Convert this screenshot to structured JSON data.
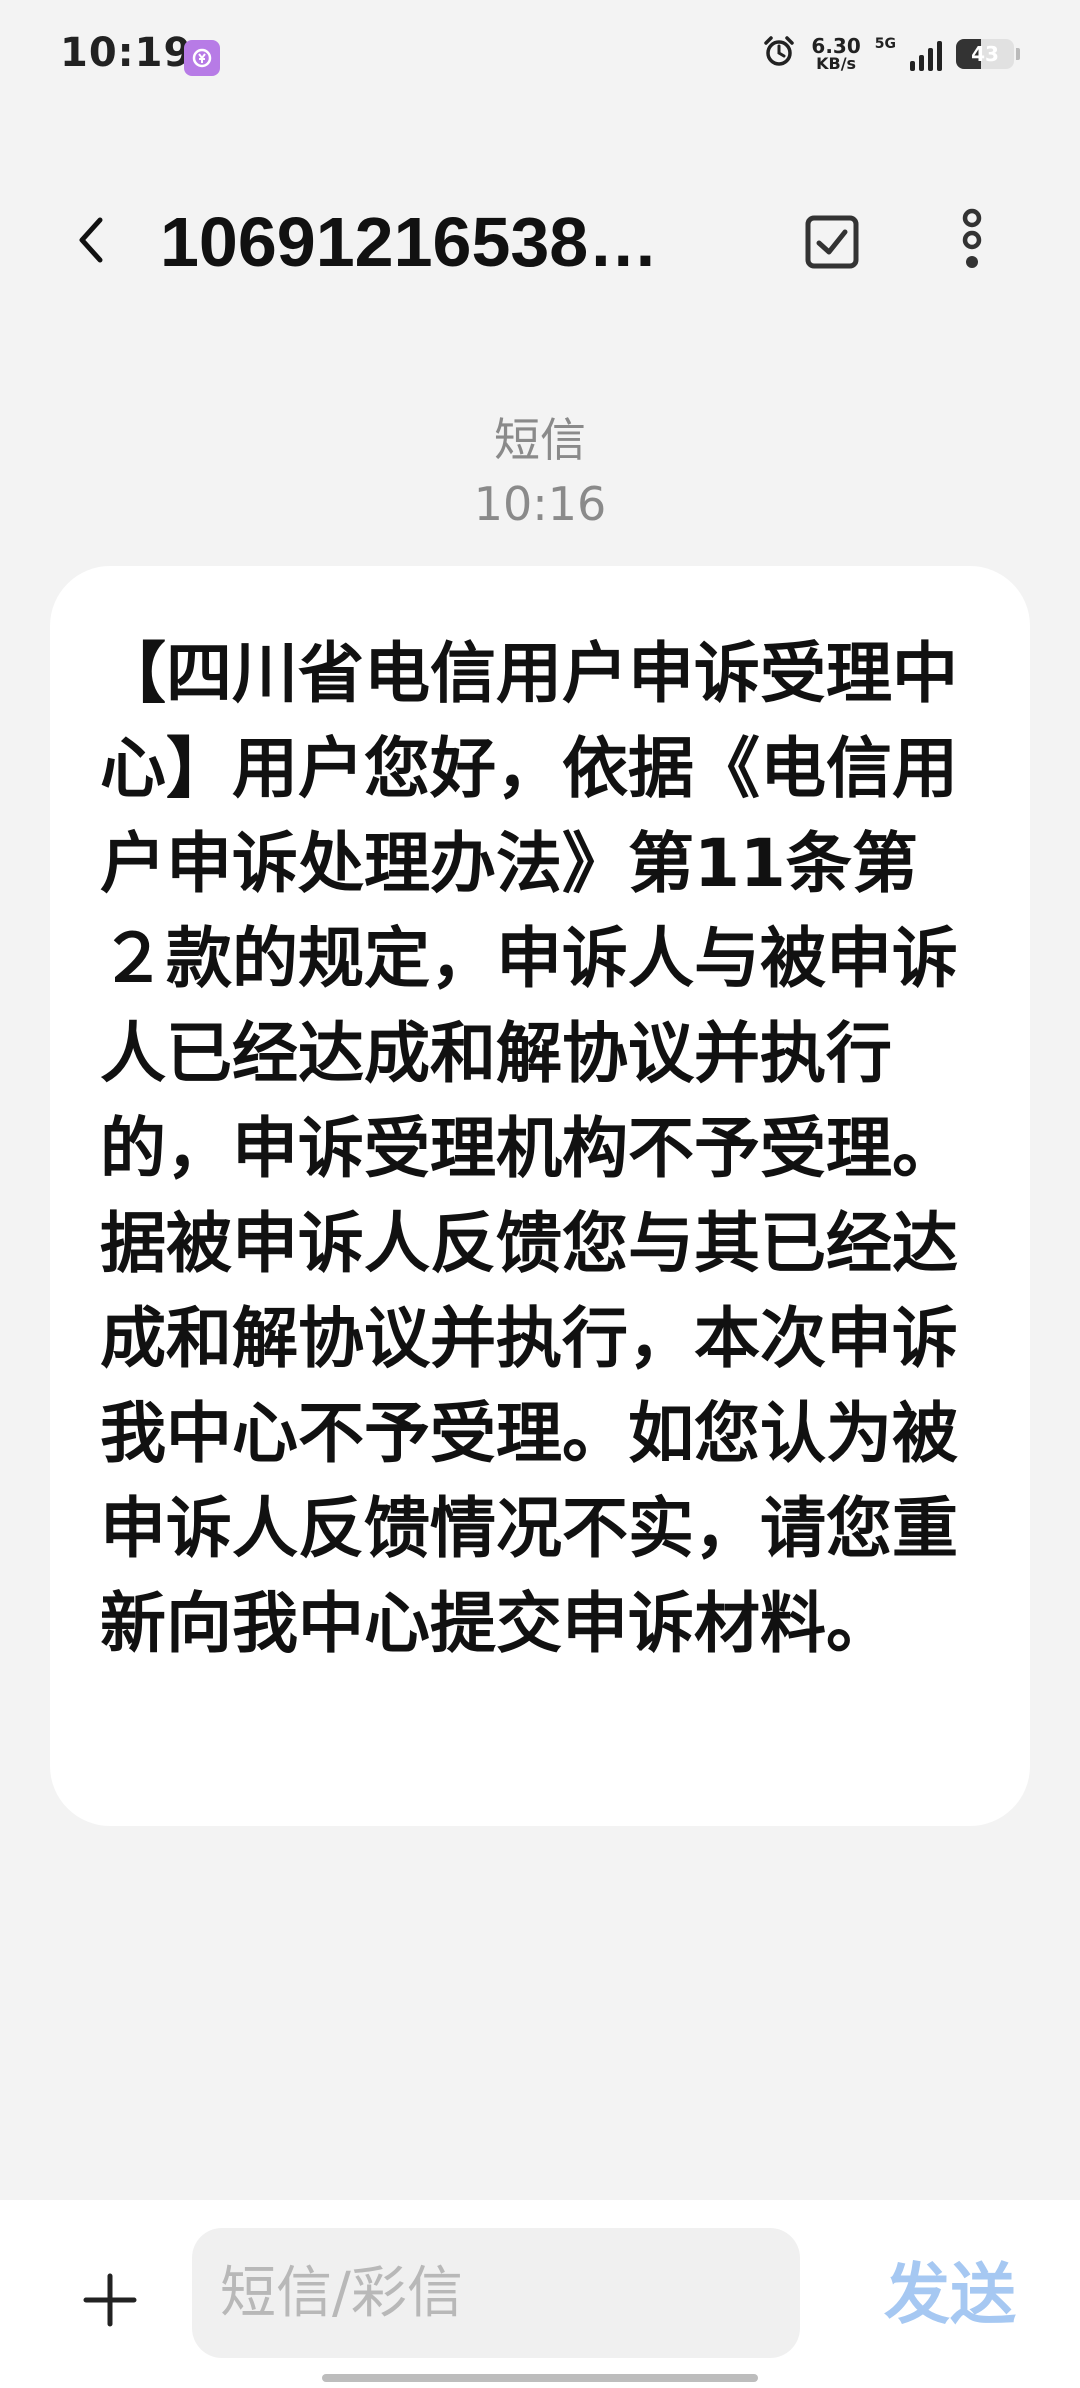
{
  "status_bar": {
    "time": "10:19",
    "net_speed_value": "6.30",
    "net_speed_unit": "KB/s",
    "network_type": "5G",
    "battery_percent": "43",
    "battery_level": 0.43,
    "icons": [
      "app-badge-icon",
      "alarm-icon",
      "signal-icon",
      "battery-icon"
    ]
  },
  "header": {
    "title": "10691216538…",
    "icons": [
      "back-chevron-icon",
      "select-checkbox-icon",
      "more-vertical-icon"
    ]
  },
  "message": {
    "type_label": "短信",
    "time": "10:16",
    "body": "【四川省电信用户申诉受理中心】用户您好，依据《电信用户申诉处理办法》第11条第２款的规定，申诉人与被申诉人已经达成和解协议并执行的，申诉受理机构不予受理。据被申诉人反馈您与其已经达成和解协议并执行，本次申诉我中心不予受理。如您认为被申诉人反馈情况不实，请您重新向我中心提交申诉材料。"
  },
  "composer": {
    "placeholder": "短信/彩信",
    "value": "",
    "send_label": "发送",
    "add_icon": "plus-icon"
  },
  "colors": {
    "background": "#f3f3f3",
    "bubble": "#ffffff",
    "meta_text": "#8a8a8a",
    "send_disabled": "#a6c8f2"
  }
}
